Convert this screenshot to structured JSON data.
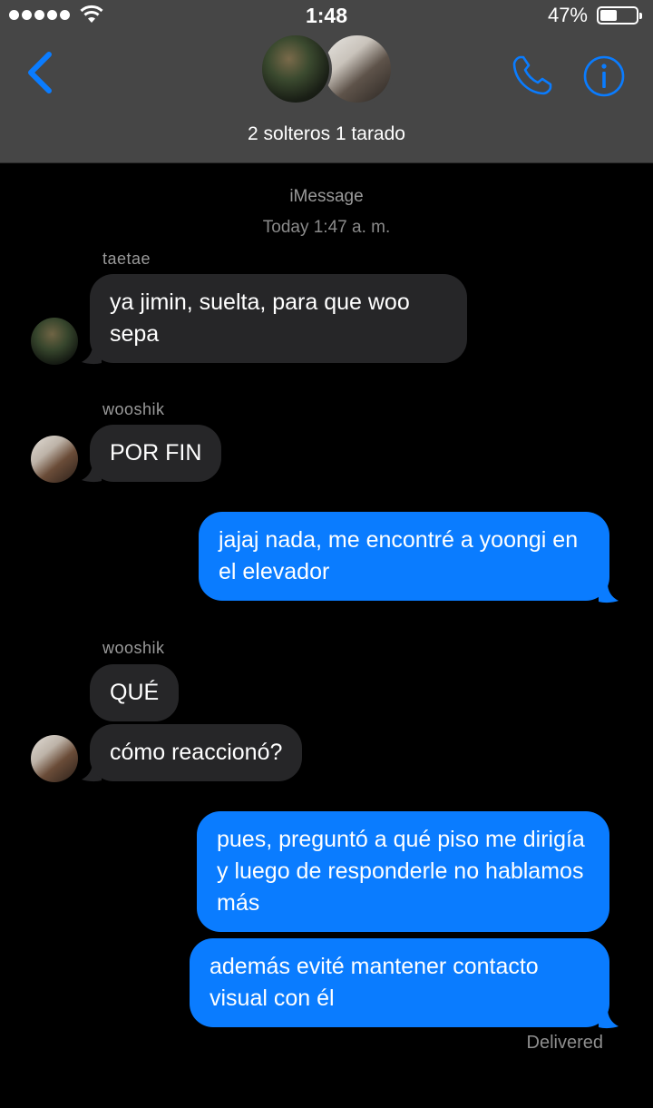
{
  "status_bar": {
    "time": "1:48",
    "battery_percent": "47%",
    "battery_level": 0.47
  },
  "header": {
    "group_name": "2 solteros 1 tarado",
    "accent_color": "#0a7cff"
  },
  "conversation": {
    "service": "iMessage",
    "timestamp": "Today 1:47 a. m.",
    "messages": [
      {
        "sender": "taetae",
        "text": "ya jimin, suelta, para que woo sepa",
        "direction": "incoming"
      },
      {
        "sender": "wooshik",
        "text": "POR FIN",
        "direction": "incoming"
      },
      {
        "text": "jajaj nada, me encontré a yoongi en el elevador",
        "direction": "outgoing"
      },
      {
        "sender": "wooshik",
        "text": "QUÉ",
        "direction": "incoming"
      },
      {
        "text": "cómo reaccionó?",
        "direction": "incoming"
      },
      {
        "text": "pues, preguntó a qué piso me dirigía y luego de responderle no hablamos más",
        "direction": "outgoing"
      },
      {
        "text": "además evité mantener contacto visual con él",
        "direction": "outgoing"
      }
    ],
    "delivered_label": "Delivered"
  }
}
